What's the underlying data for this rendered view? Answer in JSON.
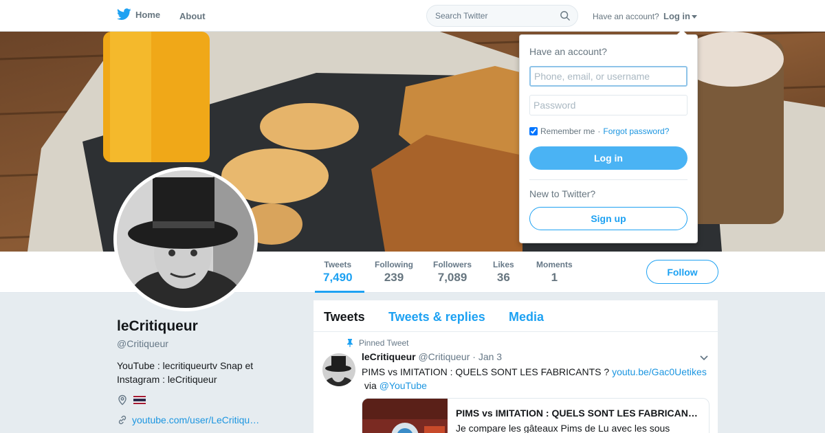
{
  "nav": {
    "home_label": "Home",
    "about_label": "About",
    "search_placeholder": "Search Twitter",
    "have_account": "Have an account?",
    "login_label": "Log in"
  },
  "profile": {
    "name": "leCritiqueur",
    "handle": "@Critiqueur",
    "bio": "YouTube : lecritiqueurtv Snap et Instagram : leCritiqueur",
    "location_flag": "🇹🇭",
    "url": "youtube.com/user/LeCritiqu…"
  },
  "stats": [
    {
      "label": "Tweets",
      "value": "7,490"
    },
    {
      "label": "Following",
      "value": "239"
    },
    {
      "label": "Followers",
      "value": "7,089"
    },
    {
      "label": "Likes",
      "value": "36"
    },
    {
      "label": "Moments",
      "value": "1"
    }
  ],
  "follow_label": "Follow",
  "timeline": {
    "tabs": [
      "Tweets",
      "Tweets & replies",
      "Media"
    ],
    "pinned_label": "Pinned Tweet",
    "tweet": {
      "name": "leCritiqueur",
      "handle": "@Critiqueur",
      "date": "· Jan 3",
      "text": "PIMS vs IMITATION : QUELS SONT LES FABRICANTS ?",
      "link": "youtu.be/Gac0Uetikes",
      "via": "via",
      "mention": "@YouTube",
      "card_title": "PIMS vs IMITATION : QUELS SONT LES FABRICANTS ?",
      "card_desc": "Je compare les gâteaux Pims de Lu avec les sous"
    }
  },
  "login_dropdown": {
    "title": "Have an account?",
    "username_placeholder": "Phone, email, or username",
    "password_placeholder": "Password",
    "remember_label": "Remember me",
    "separator": "·",
    "forgot_label": "Forgot password?",
    "login_button": "Log in",
    "new_label": "New to Twitter?",
    "signup_button": "Sign up"
  },
  "colors": {
    "brand": "#1da1f2",
    "link": "#1b95e0",
    "login_button": "#4ab3f4"
  }
}
